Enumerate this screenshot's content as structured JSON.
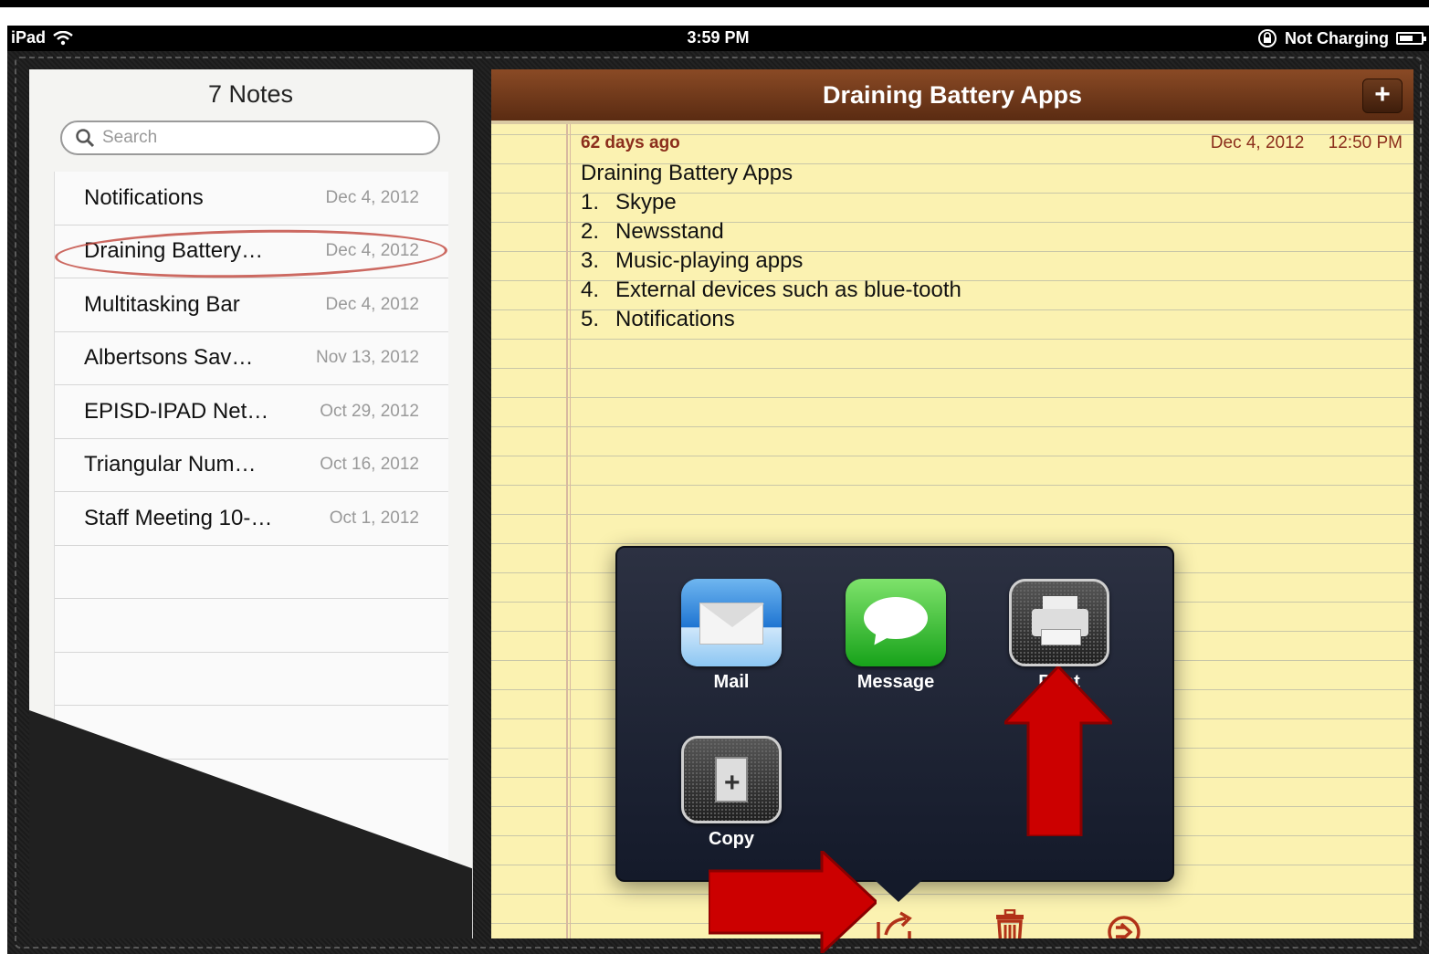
{
  "status_bar": {
    "device": "iPad",
    "time": "3:59 PM",
    "charging": "Not Charging"
  },
  "list_pane": {
    "title": "7 Notes",
    "search_placeholder": "Search",
    "notes": [
      {
        "title": "Notifications",
        "date": "Dec 4, 2012"
      },
      {
        "title": "Draining Battery…",
        "date": "Dec 4, 2012"
      },
      {
        "title": "Multitasking Bar",
        "date": "Dec 4, 2012"
      },
      {
        "title": "Albertsons Sav…",
        "date": "Nov 13, 2012"
      },
      {
        "title": "EPISD-IPAD Net…",
        "date": "Oct 29, 2012"
      },
      {
        "title": "Triangular Num…",
        "date": "Oct 16, 2012"
      },
      {
        "title": "Staff Meeting 10-…",
        "date": "Oct 1, 2012"
      }
    ]
  },
  "note": {
    "header_title": "Draining Battery Apps",
    "add_label": "+",
    "age": "62 days ago",
    "date": "Dec 4, 2012",
    "time": "12:50 PM",
    "heading": "Draining Battery Apps",
    "items": [
      {
        "num": "1.",
        "text": "Skype"
      },
      {
        "num": "2.",
        "text": "Newsstand"
      },
      {
        "num": "3.",
        "text": "Music-playing apps"
      },
      {
        "num": "4.",
        "text": "External devices such as blue-tooth"
      },
      {
        "num": "5.",
        "text": "Notifications"
      }
    ]
  },
  "share_menu": {
    "mail": "Mail",
    "message": "Message",
    "print": "Print",
    "copy": "Copy"
  },
  "colors": {
    "annotation_red": "#cc0000",
    "note_meta": "#8b2e1c",
    "toolbar_icon": "#b13218"
  }
}
